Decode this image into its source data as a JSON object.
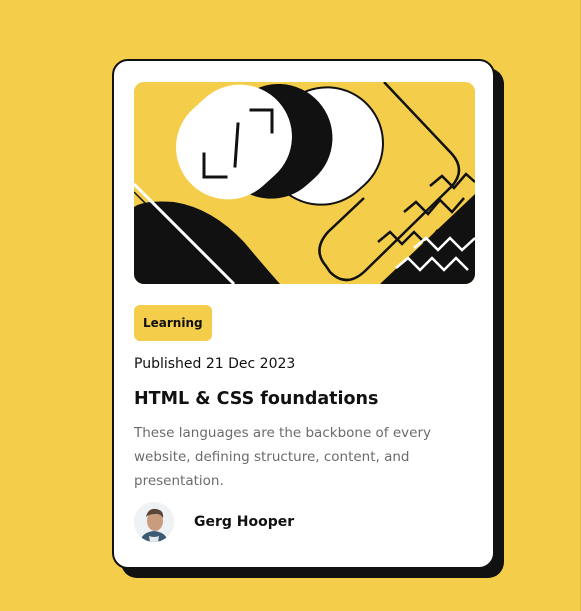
{
  "colors": {
    "background": "#F4CE4B",
    "card": "#FFFFFF",
    "ink": "#111111",
    "muted_text": "#6B6B6B"
  },
  "card": {
    "hero_image": "abstract yellow, black and white geometric illustration",
    "tag_label": "Learning",
    "published": "Published 21 Dec 2023",
    "title": "HTML & CSS foundations",
    "description": "These languages are the backbone of every website, defining structure, content, and presentation.",
    "author": {
      "name": "Gerg Hooper",
      "avatar_icon": "person-avatar-icon"
    }
  }
}
